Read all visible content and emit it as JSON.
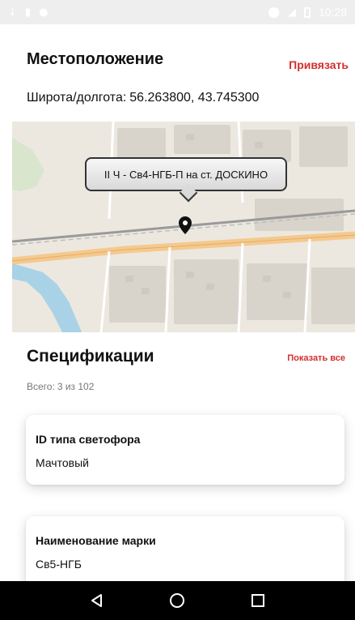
{
  "status_bar": {
    "time": "10:28",
    "icons": [
      "download-icon",
      "sim-card-icon",
      "notification-icon",
      "location-icon",
      "signal-icon",
      "battery-icon"
    ]
  },
  "location": {
    "title": "Местоположение",
    "bind_label": "Привязать",
    "coords_label": "Широта/долгота:",
    "coords_value": "56.263800, 43.745300"
  },
  "map": {
    "marker_label": "II Ч - Св4-НГБ-П на ст. ДОСКИНО",
    "colors": {
      "land": "#ece8e0",
      "water": "#a9d2e6",
      "road": "#f5c98e",
      "building": "#d8d4cc"
    }
  },
  "specs": {
    "title": "Спецификации",
    "show_all_label": "Показать все",
    "total_label": "Всего:",
    "total_value": "3 из 102",
    "cards": [
      {
        "label": "ID типа светофора",
        "value": "Мачтовый"
      },
      {
        "label": "Наименование марки",
        "value": "Св5-НГБ"
      }
    ]
  },
  "accent_color": "#d32f2f",
  "nav_bar": {
    "icons": [
      "back-icon",
      "home-icon",
      "recents-icon"
    ]
  }
}
